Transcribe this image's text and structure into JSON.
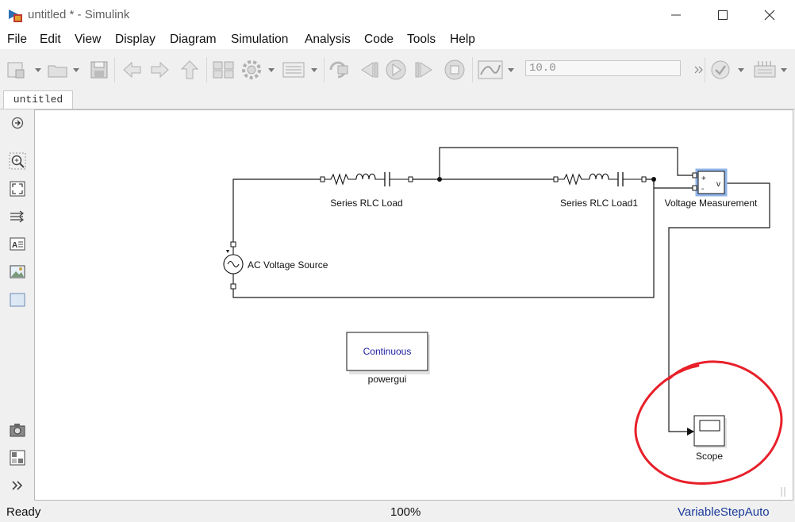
{
  "window": {
    "title": "untitled * - Simulink"
  },
  "menu": [
    "File",
    "Edit",
    "View",
    "Display",
    "Diagram",
    "Simulation",
    "Analysis",
    "Code",
    "Tools",
    "Help"
  ],
  "toolbar": {
    "stop_time": "10.0"
  },
  "tabs": [
    {
      "label": "untitled"
    }
  ],
  "blocks": {
    "rlc_load": "Series RLC Load",
    "rlc_load1": "Series RLC Load1",
    "voltage_measurement": "Voltage Measurement",
    "vm_plus": "+",
    "vm_minus": "-",
    "vm_v": "v",
    "ac_source": "AC Voltage Source",
    "powergui_text": "Continuous",
    "powergui": "powergui",
    "scope": "Scope"
  },
  "status": {
    "state": "Ready",
    "zoom": "100%",
    "solver": "VariableStepAuto"
  },
  "colors": {
    "annotation_circle": "#e8202a",
    "powergui_text": "#1a1aa0",
    "solver_text": "#1a3a9a"
  }
}
